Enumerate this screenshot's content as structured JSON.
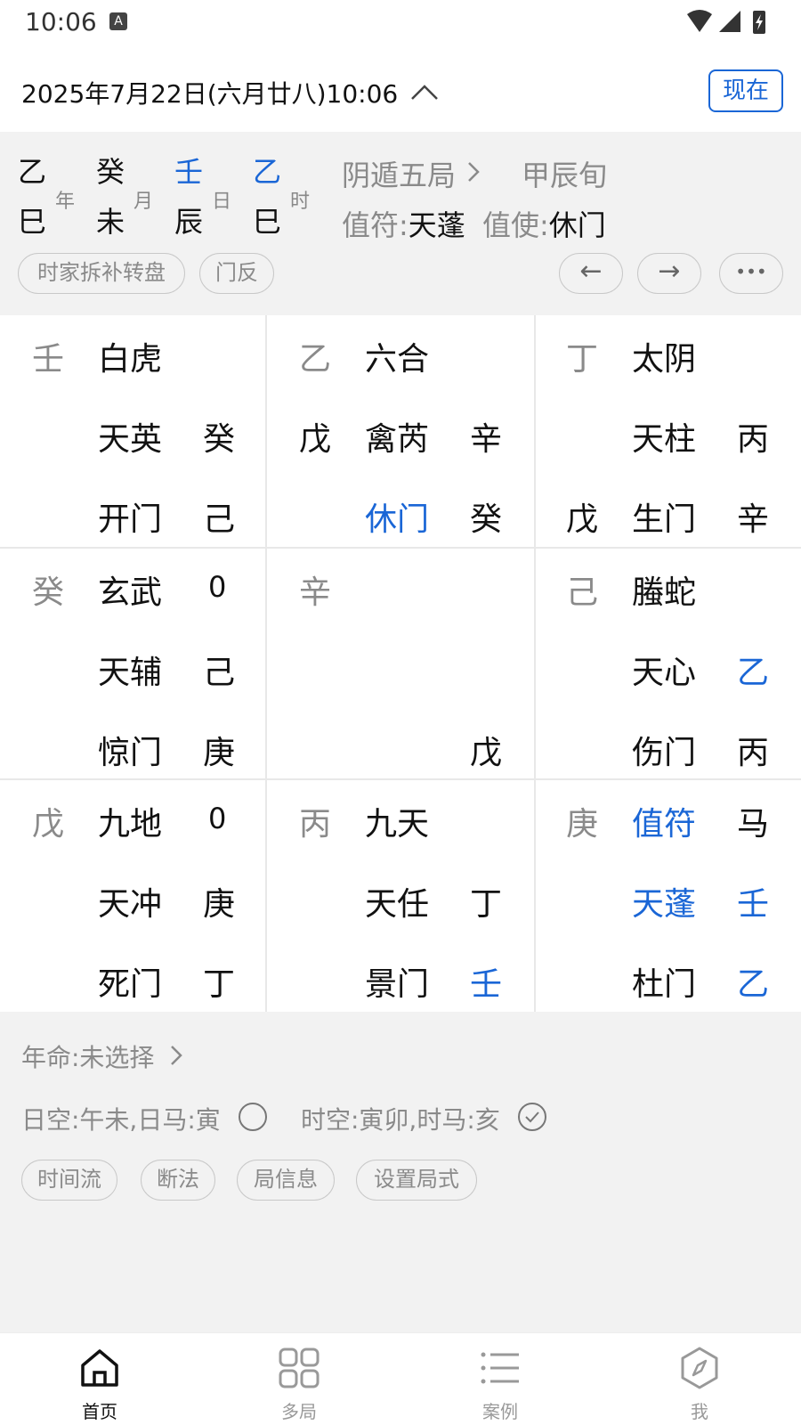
{
  "status_bar": {
    "time": "10:06",
    "indicator": "A"
  },
  "header": {
    "date_text": "2025年7月22日(六月廿八)10:06",
    "now_button": "现在"
  },
  "pillars": [
    {
      "gan": "乙",
      "zhi": "巳",
      "label": "年",
      "gan_color": "#111111"
    },
    {
      "gan": "癸",
      "zhi": "未",
      "label": "月",
      "gan_color": "#111111"
    },
    {
      "gan": "壬",
      "zhi": "辰",
      "label": "日",
      "gan_color": "#1a66d6"
    },
    {
      "gan": "乙",
      "zhi": "巳",
      "label": "时",
      "gan_color": "#1a66d6"
    }
  ],
  "ju": {
    "name": "阴遁五局",
    "xun": "甲辰旬"
  },
  "zhifu": {
    "label": "值符:",
    "value": "天蓬"
  },
  "zhishi": {
    "label": "值使:",
    "value": "休门"
  },
  "chips": {
    "chaibu": "时家拆补转盘",
    "menfan": "门反",
    "prev": "←",
    "next": "→",
    "more": "•••"
  },
  "palaces": [
    {
      "tl": "壬",
      "god": "白虎",
      "r1": "",
      "l2": "",
      "star": "天英",
      "r2": "癸",
      "l3": "",
      "door": "开门",
      "r3": "己"
    },
    {
      "tl": "乙",
      "god": "六合",
      "r1": "",
      "l2": "戊",
      "star": "禽芮",
      "r2": "辛",
      "l3": "",
      "door": "休门",
      "r3": "癸"
    },
    {
      "tl": "丁",
      "god": "太阴",
      "r1": "",
      "l2": "",
      "star": "天柱",
      "r2": "丙",
      "l3": "戊",
      "door": "生门",
      "r3": "辛"
    },
    {
      "tl": "癸",
      "god": "玄武",
      "r1": "0",
      "l2": "",
      "star": "天辅",
      "r2": "己",
      "l3": "",
      "door": "惊门",
      "r3": "庚"
    },
    {
      "tl": "辛",
      "god": "",
      "r1": "",
      "l2": "",
      "star": "",
      "r2": "",
      "l3": "",
      "door": "",
      "r3": "戊"
    },
    {
      "tl": "己",
      "god": "螣蛇",
      "r1": "",
      "l2": "",
      "star": "天心",
      "r2": "乙",
      "l3": "",
      "door": "伤门",
      "r3": "丙"
    },
    {
      "tl": "戊",
      "god": "九地",
      "r1": "0",
      "l2": "",
      "star": "天冲",
      "r2": "庚",
      "l3": "",
      "door": "死门",
      "r3": "丁"
    },
    {
      "tl": "丙",
      "god": "九天",
      "r1": "",
      "l2": "",
      "star": "天任",
      "r2": "丁",
      "l3": "",
      "door": "景门",
      "r3": "壬"
    },
    {
      "tl": "庚",
      "god": "值符",
      "r1": "马",
      "l2": "",
      "star": "天蓬",
      "r2": "壬",
      "l3": "",
      "door": "杜门",
      "r3": "乙"
    }
  ],
  "bottom": {
    "nianming": "年命:未选择",
    "rikong": "日空:午未,日马:寅",
    "shikong": "时空:寅卯,时马:亥",
    "actions": [
      "时间流",
      "断法",
      "局信息",
      "设置局式"
    ]
  },
  "tabbar": [
    {
      "label": "首页",
      "icon": "home-icon"
    },
    {
      "label": "多局",
      "icon": "grid-icon"
    },
    {
      "label": "案例",
      "icon": "list-icon"
    },
    {
      "label": "我",
      "icon": "compass-icon"
    }
  ],
  "colors": {
    "accent": "#1a66d6",
    "muted": "#8a8a8a",
    "panel": "#f2f2f2"
  }
}
